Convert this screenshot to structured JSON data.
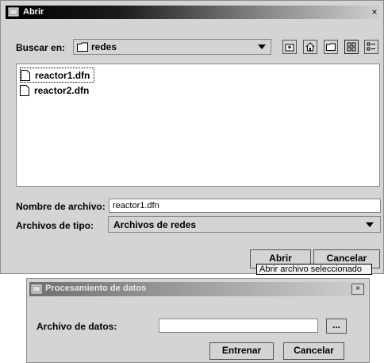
{
  "open_dialog": {
    "title": "Abrir",
    "close_symbol": "×",
    "look_in_label": "Buscar en:",
    "folder": "redes",
    "files": [
      "reactor1.dfn",
      "reactor2.dfn"
    ],
    "filename_label": "Nombre de archivo:",
    "filename_value": "reactor1.dfn",
    "filetype_label": "Archivos de tipo:",
    "filetype_value": "Archivos de redes",
    "open_button": "Abrir",
    "cancel_button": "Cancelar",
    "tooltip": "Abrir archivo seleccionado",
    "toolbar_icons": [
      "up-folder-icon",
      "home-icon",
      "new-folder-icon",
      "list-view-icon",
      "details-view-icon"
    ]
  },
  "process_dialog": {
    "title": "Procesamiento de datos",
    "close_symbol": "×",
    "data_file_label": "Archivo de datos:",
    "data_file_value": "",
    "browse_button": "...",
    "train_button": "Entrenar",
    "cancel_button": "Cancelar"
  }
}
